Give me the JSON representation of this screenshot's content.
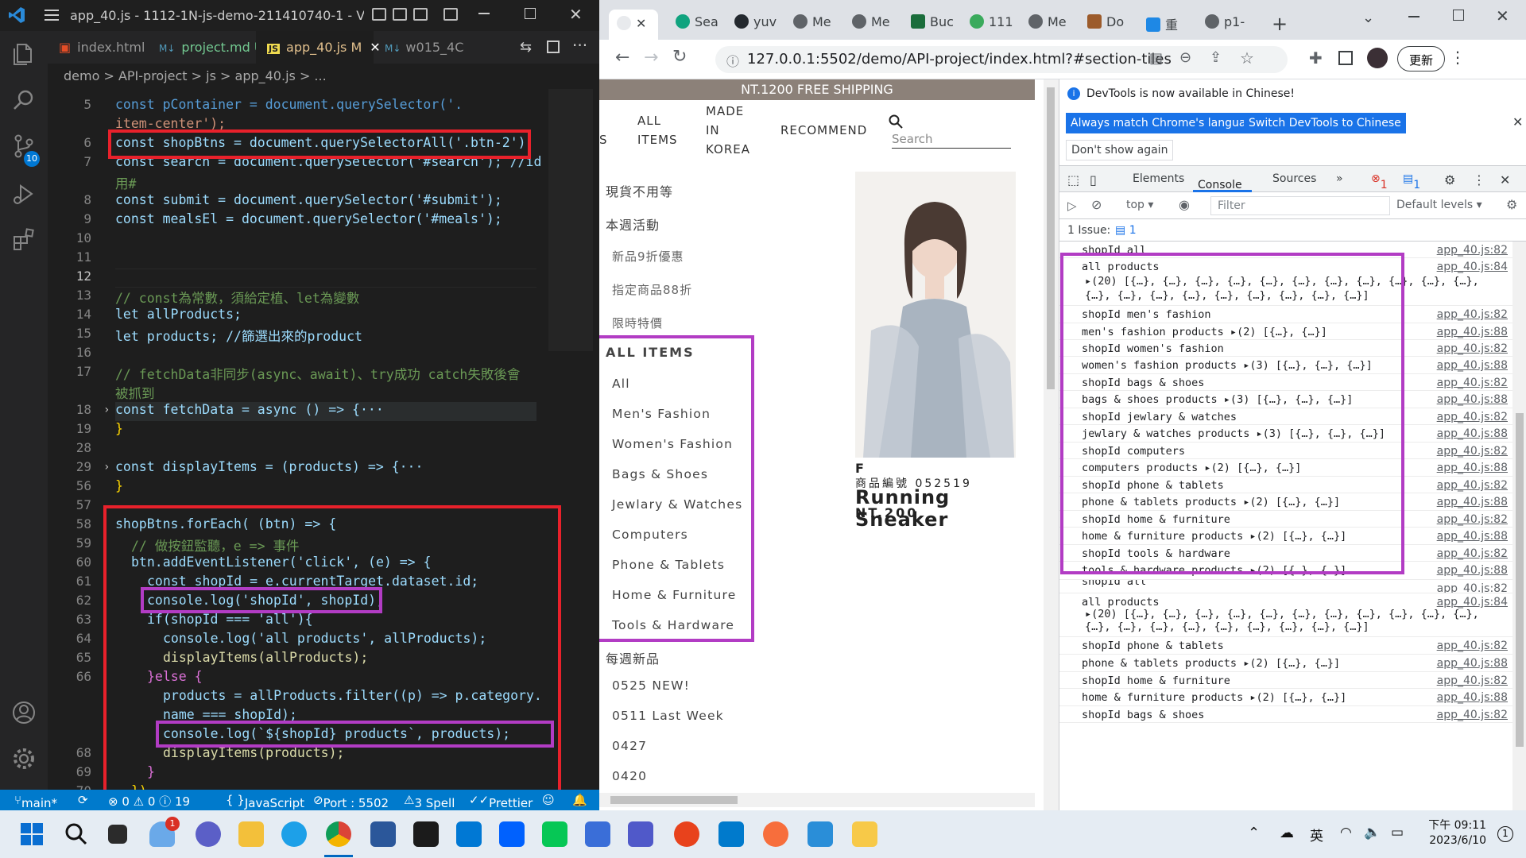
{
  "vscode": {
    "title": "app_40.js - 1112-1N-js-demo-211410740-1 - Visual St...",
    "tabs": [
      {
        "label": "index.html",
        "badge": ""
      },
      {
        "label": "project.md",
        "badge": "U"
      },
      {
        "label": "app_40.js",
        "badge": "M"
      },
      {
        "label": "w015_4C",
        "badge": ""
      }
    ],
    "breadcrumb": "demo > API-project > js > app_40.js > ...",
    "line_numbers": [
      "5",
      "",
      "6",
      "7",
      "",
      "8",
      "9",
      "10",
      "11",
      "12",
      "13",
      "14",
      "15",
      "16",
      "17",
      "",
      "18",
      "19",
      "28",
      "29",
      "56",
      "57",
      "58",
      "59",
      "60",
      "61",
      "62",
      "63",
      "64",
      "65",
      "66",
      "67",
      "",
      "68",
      "69",
      "70",
      "71"
    ],
    "code": {
      "l5": "const pContainer = document.querySelector('.",
      "l5b": "item-center');",
      "l6": "const shopBtns = document.querySelectorAll('.btn-2');",
      "l7": "const search = document.querySelector('#search'); //id",
      "l7b": "用#",
      "l8": "const submit = document.querySelector('#submit');",
      "l9": "const mealsEl = document.querySelector('#meals');",
      "l13": "// const為常數，須給定植、let為變數",
      "l14": "let allProducts;",
      "l15": "let products; //篩選出來的product",
      "l17": "// fetchData非同步(async、await)、try成功 catch失敗後會",
      "l17b": "被抓到",
      "l18": "const fetchData = async () => {···",
      "l19": "}",
      "l29": "const displayItems = (products) => {···",
      "l56": "}",
      "l58": "shopBtns.forEach( (btn) => {",
      "l59": "// 做按鈕監聽，e => 事件",
      "l60": "btn.addEventListener('click', (e) => {",
      "l61": "const shopId = e.currentTarget.dataset.id;",
      "l62": "console.log('shopId', shopId);",
      "l63": "if(shopId === 'all'){",
      "l64": "console.log('all products', allProducts);",
      "l65": "displayItems(allProducts);",
      "l66": "}else {",
      "l67": "products = allProducts.filter((p) => p.category.",
      "l67b": "name === shopId);",
      "l68": "console.log(`${shopId} products`, products);",
      "l69": "displayItems(products);",
      "l70": "}",
      "l71": "})"
    },
    "status": {
      "branch": "main*",
      "problems": "⊗ 0 ⚠ 0 ⓘ 19",
      "language": "JavaScript",
      "port": "Port : 5502",
      "spell": "3 Spell",
      "prettier": "Prettier"
    },
    "colors": {
      "status_bg": "#007acc",
      "highlight_red": "#e8212b",
      "highlight_purple": "#b23cc4"
    }
  },
  "chrome": {
    "tabs": [
      "Sea",
      "yuv",
      "Me",
      "Me",
      "Buc",
      "111",
      "Me",
      "Do",
      "重",
      "p1-"
    ],
    "url": "127.0.0.1:5502/demo/API-project/index.html?#section-tiles",
    "update_label": "更新",
    "page": {
      "banner": "NT.1200 FREE SHIPPING",
      "nav": [
        "S",
        "ALL ITEMS",
        "MADE IN KOREA",
        "RECOMMEND"
      ],
      "search_placeholder": "Search",
      "sidebar_top": [
        "現貨不用等",
        "本週活動",
        "新品9折優惠",
        "指定商品88折",
        "限時特價"
      ],
      "all_items_heading": "ALL ITEMS",
      "categories": [
        "All",
        "Men's Fashion",
        "Women's Fashion",
        "Bags & Shoes",
        "Jewlary & Watches",
        "Computers",
        "Phone & Tablets",
        "Home & Furniture",
        "Tools & Hardware"
      ],
      "weekly_heading": "每週新品",
      "weekly": [
        "0525 NEW!",
        "0511 Last Week",
        "0427",
        "0420"
      ],
      "product": {
        "tag": "F",
        "code": "商品編號 052519",
        "name": "Running Sneaker",
        "price": "NT.200"
      }
    },
    "devtools": {
      "notice": "DevTools is now available in Chinese!",
      "btn_match": "Always match Chrome's language",
      "btn_switch": "Switch DevTools to Chinese",
      "btn_dont": "Don't show again",
      "tabs": [
        "Elements",
        "Console",
        "Sources"
      ],
      "errors": "1",
      "messages": "1",
      "context": "top",
      "filter_placeholder": "Filter",
      "levels": "Default levels",
      "issues": "1 Issue:",
      "issues_count": "1",
      "logs": [
        {
          "text": "shopId all",
          "src": "app_40.js:82"
        },
        {
          "text": "all products",
          "src": "app_40.js:84",
          "line2": "▸(20) [{…}, {…}, {…}, {…}, {…}, {…}, {…}, {…}, {…}, {…}, {…},",
          "line3": "{…}, {…}, {…}, {…}, {…}, {…}, {…}, {…}, {…}]"
        },
        {
          "text": "shopId men's fashion",
          "src": "app_40.js:82"
        },
        {
          "text": "men's fashion products ▸(2) [{…}, {…}]",
          "src": "app_40.js:88"
        },
        {
          "text": "shopId women's fashion",
          "src": "app_40.js:82"
        },
        {
          "text": "women's fashion products ▸(3) [{…}, {…}, {…}]",
          "src": "app_40.js:88"
        },
        {
          "text": "shopId bags & shoes",
          "src": "app_40.js:82"
        },
        {
          "text": "bags & shoes products ▸(3) [{…}, {…}, {…}]",
          "src": "app_40.js:88"
        },
        {
          "text": "shopId jewlary & watches",
          "src": "app_40.js:82"
        },
        {
          "text": "jewlary & watches products ▸(3) [{…}, {…}, {…}]",
          "src": "app_40.js:88"
        },
        {
          "text": "shopId computers",
          "src": "app_40.js:82"
        },
        {
          "text": "computers products ▸(2) [{…}, {…}]",
          "src": "app_40.js:88"
        },
        {
          "text": "shopId phone & tablets",
          "src": "app_40.js:82"
        },
        {
          "text": "phone & tablets products ▸(2) [{…}, {…}]",
          "src": "app_40.js:88"
        },
        {
          "text": "shopId home & furniture",
          "src": "app_40.js:82"
        },
        {
          "text": "home & furniture products ▸(2) [{…}, {…}]",
          "src": "app_40.js:88"
        },
        {
          "text": "shopId tools & hardware",
          "src": "app_40.js:82"
        },
        {
          "text": "tools & hardware products ▸(2) [{…}, {…}]",
          "src": "app_40.js:88"
        },
        {
          "text": "shopId all",
          "src": "app_40.js:82"
        },
        {
          "text": "all products",
          "src": "app_40.js:84",
          "line2": "▸(20) [{…}, {…}, {…}, {…}, {…}, {…}, {…}, {…}, {…}, {…}, {…},",
          "line3": "{…}, {…}, {…}, {…}, {…}, {…}, {…}, {…}, {…}]"
        },
        {
          "text": "shopId phone & tablets",
          "src": "app_40.js:82"
        },
        {
          "text": "phone & tablets products ▸(2) [{…}, {…}]",
          "src": "app_40.js:88"
        },
        {
          "text": "shopId home & furniture",
          "src": "app_40.js:82"
        },
        {
          "text": "home & furniture products ▸(2) [{…}, {…}]",
          "src": "app_40.js:88"
        },
        {
          "text": "shopId bags & shoes",
          "src": "app_40.js:82"
        }
      ]
    }
  },
  "taskbar": {
    "time": "下午 09:11",
    "date": "2023/6/10",
    "lang": "英",
    "notif_badge": "1"
  }
}
